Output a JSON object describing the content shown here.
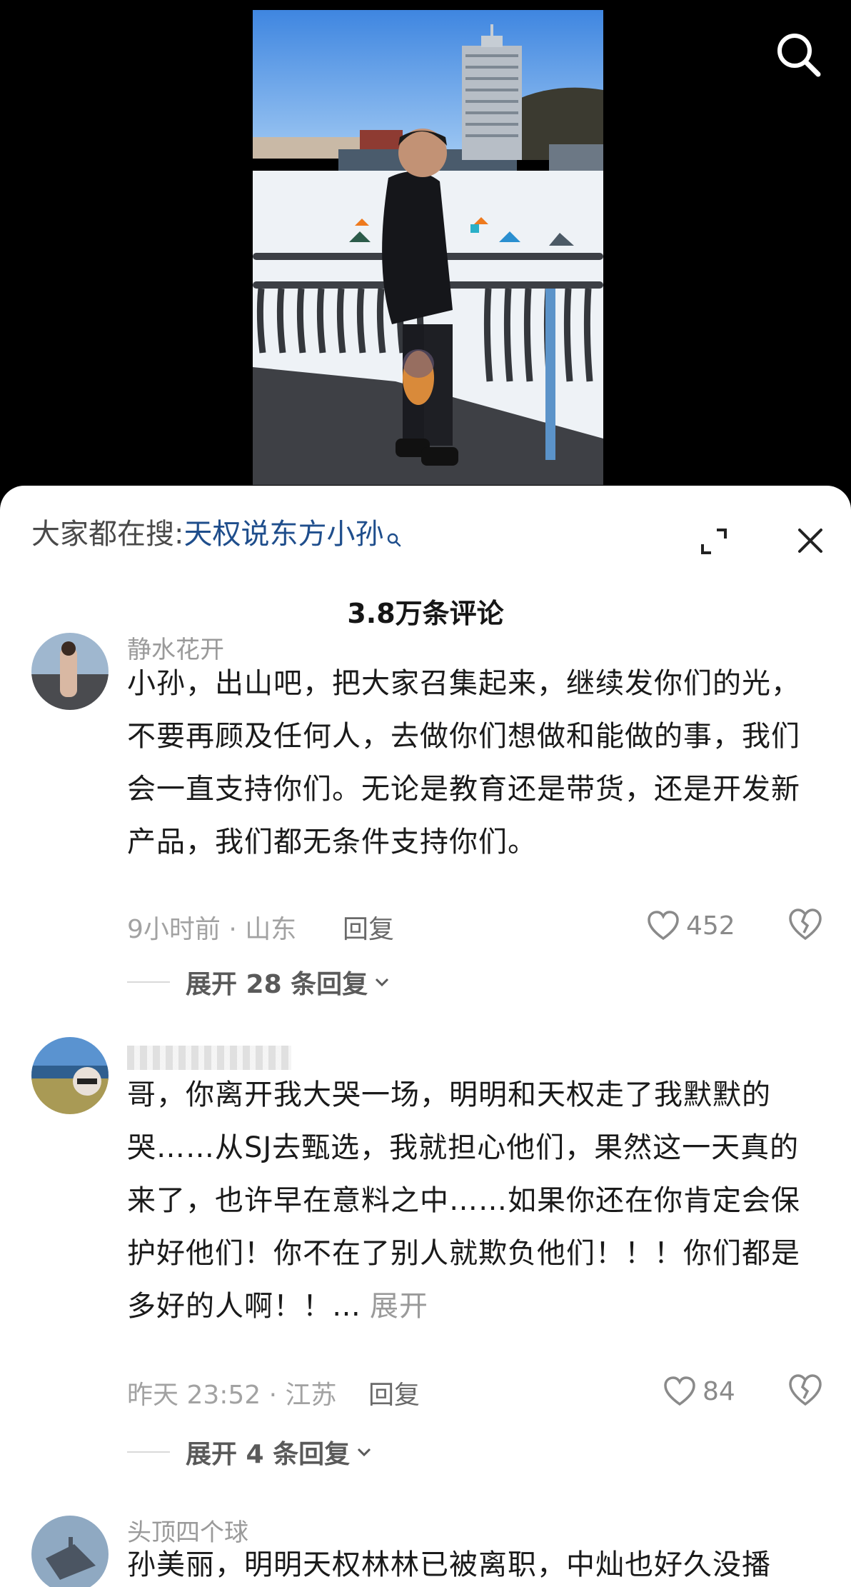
{
  "header": {
    "hot_search_prefix": "大家都在搜:",
    "hot_search_keyword": "天权说东方小孙",
    "comment_count": "3.8万条评论"
  },
  "comments": [
    {
      "username": "静水花开",
      "content": "小孙，出山吧，把大家召集起来，继续发你们的光，不要再顾及任何人，去做你们想做和能做的事，我们会一直支持你们。无论是教育还是带货，还是开发新产品，我们都无条件支持你们。",
      "more_label": "",
      "time_location": "9小时前 · 山东",
      "reply_label": "回复",
      "likes": "452",
      "expand_label": "展开 28 条回复"
    },
    {
      "username": "",
      "content": "哥，你离开我大哭一场，明明和天权走了我默默的哭……从SJ去甄选，我就担心他们，果然这一天真的来了，也许早在意料之中……如果你还在你肯定会保护好他们！你不在了别人就欺负他们！！！你们都是多好的人啊！！…",
      "more_label": "展开",
      "time_location": "昨天 23:52 · 江苏",
      "reply_label": "回复",
      "likes": "84",
      "expand_label": "展开 4 条回复"
    },
    {
      "username": "头顶四个球",
      "content": "孙美丽，明明天权林林已被离职，中灿也好久没播"
    }
  ],
  "icons": {
    "top_search": "search-icon",
    "fullscreen": "expand-icon",
    "close": "close-icon",
    "like": "heart-icon",
    "dislike": "broken-heart-icon",
    "chevron": "chevron-down-icon"
  },
  "colors": {
    "keyword_blue": "#1f4e8c",
    "meta_gray": "#a2a2a2",
    "text_black": "#1a1a1a"
  }
}
